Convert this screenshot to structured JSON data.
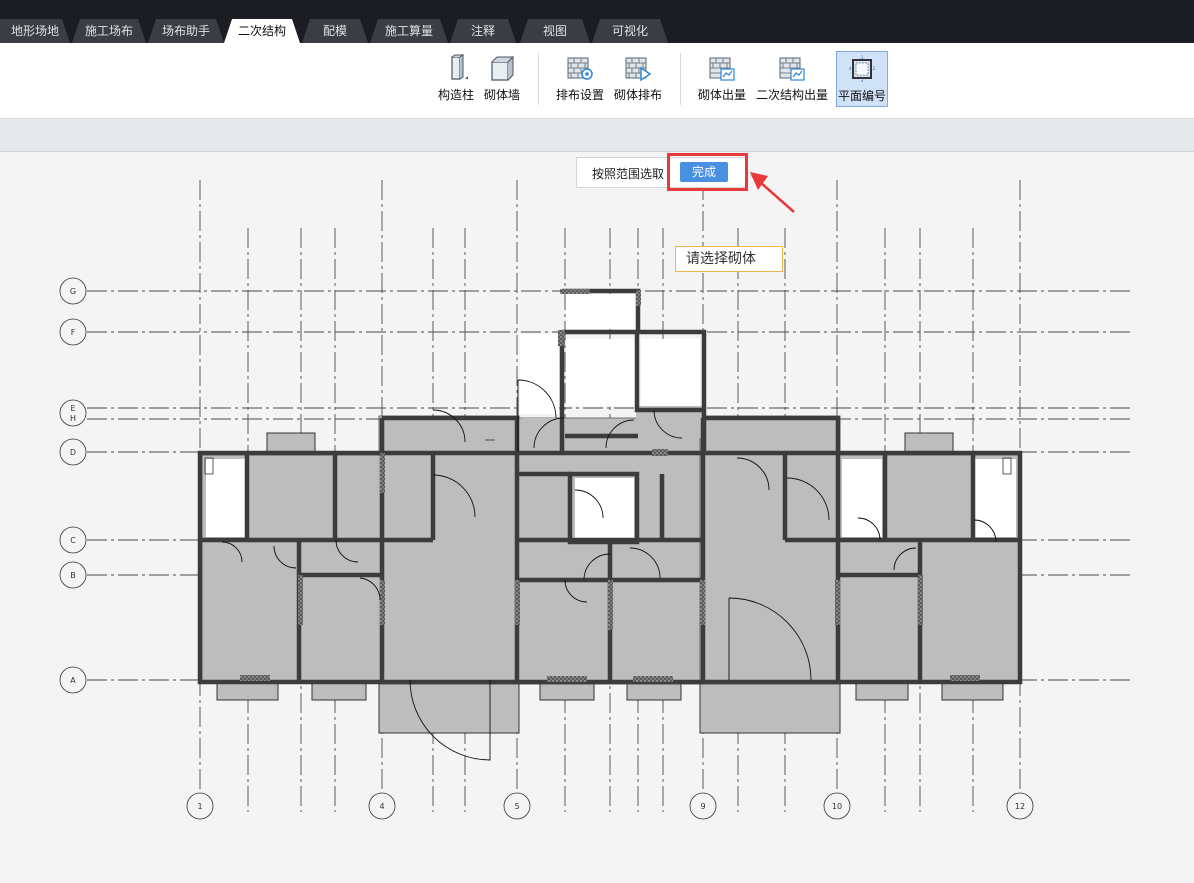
{
  "tabs": [
    {
      "label": "地形场地",
      "active": false
    },
    {
      "label": "施工场布",
      "active": false
    },
    {
      "label": "场布助手",
      "active": false
    },
    {
      "label": "二次结构",
      "active": true
    },
    {
      "label": "配模",
      "active": false
    },
    {
      "label": "施工算量",
      "active": false
    },
    {
      "label": "注释",
      "active": false
    },
    {
      "label": "视图",
      "active": false
    },
    {
      "label": "可视化",
      "active": false
    }
  ],
  "ribbon": {
    "construct_column": "构造柱",
    "masonry_wall": "砌体墙",
    "layout_settings": "排布设置",
    "masonry_layout": "砌体排布",
    "masonry_output": "砌体出量",
    "secondary_output": "二次结构出量",
    "plan_numbering": "平面编号"
  },
  "selection": {
    "range_label": "按照范围选取",
    "done_label": "完成"
  },
  "hint": "请选择砌体",
  "grid": {
    "rows": [
      "G",
      "F",
      "E",
      "H",
      "D",
      "C",
      "B",
      "A"
    ],
    "columns": [
      "1",
      "4",
      "5",
      "9",
      "10",
      "12"
    ]
  },
  "colors": {
    "accent": "#4a90e2",
    "highlight": "#e83a3a",
    "wall": "#3c3c3c",
    "room": "#bdbdbd"
  }
}
